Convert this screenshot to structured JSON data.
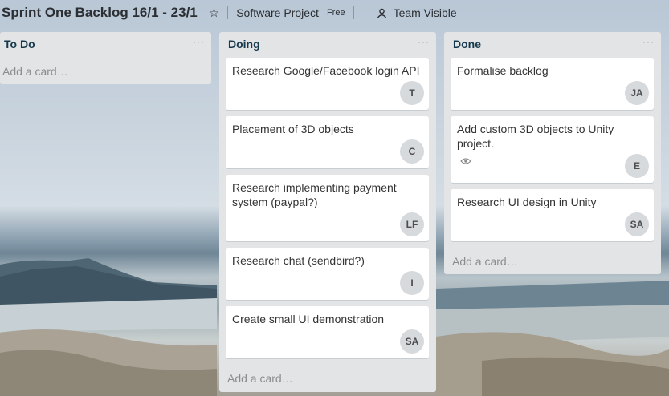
{
  "board": {
    "title": "Sprint One Backlog 16/1 - 23/1",
    "team": "Software Project",
    "plan_badge": "Free",
    "visibility": "Team Visible",
    "star_icon": "star-icon",
    "visibility_icon": "team-icon"
  },
  "lists": [
    {
      "title": "To Do",
      "menu": "···",
      "add_card": "Add a card…",
      "cards": []
    },
    {
      "title": "Doing",
      "menu": "···",
      "add_card": "Add a card…",
      "cards": [
        {
          "text": "Research Google/Facebook login API",
          "member": "T"
        },
        {
          "text": "Placement of 3D objects",
          "member": "C"
        },
        {
          "text": "Research implementing payment system (paypal?)",
          "member": "LF"
        },
        {
          "text": "Research chat (sendbird?)",
          "member": "I"
        },
        {
          "text": "Create small UI demonstration",
          "member": "SA"
        }
      ]
    },
    {
      "title": "Done",
      "menu": "···",
      "add_card": "Add a card…",
      "cards": [
        {
          "text": "Formalise backlog",
          "member": "JA"
        },
        {
          "text": "Add custom 3D objects to Unity project.",
          "member": "E",
          "badge_icon": "eye-icon"
        },
        {
          "text": "Research UI design in Unity",
          "member": "SA"
        }
      ]
    }
  ]
}
